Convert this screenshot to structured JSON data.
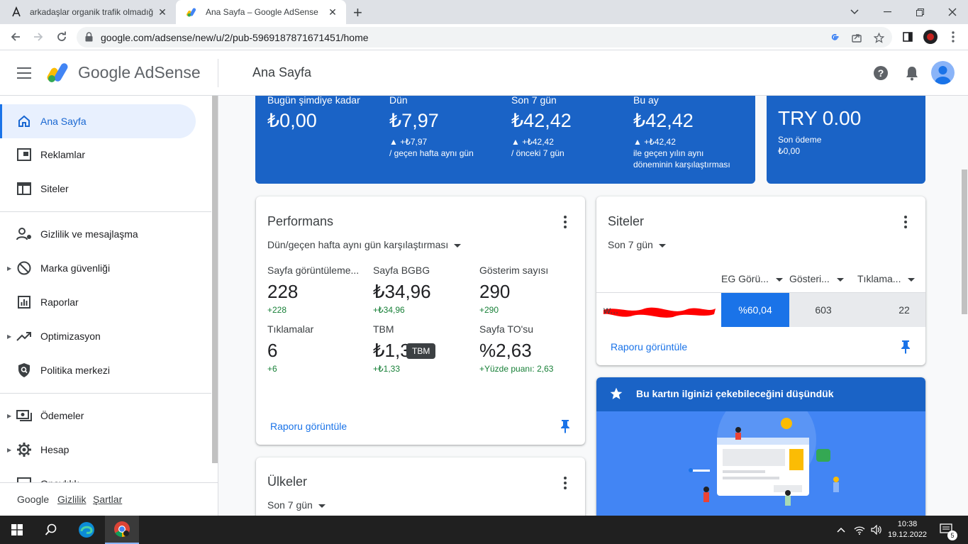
{
  "browser": {
    "tabs": [
      {
        "title": "arkadaşlar organik trafik olmadığ",
        "close": "✕"
      },
      {
        "title": "Ana Sayfa – Google AdSense",
        "close": "✕"
      }
    ],
    "url": "google.com/adsense/new/u/2/pub-5969187871671451/home"
  },
  "header": {
    "product": "Google AdSense",
    "page_title": "Ana Sayfa"
  },
  "sidebar": {
    "items": [
      {
        "label": "Ana Sayfa",
        "icon": "home-icon"
      },
      {
        "label": "Reklamlar",
        "icon": "ads-icon"
      },
      {
        "label": "Siteler",
        "icon": "sites-icon"
      },
      {
        "label": "Gizlilik ve mesajlaşma",
        "icon": "privacy-icon"
      },
      {
        "label": "Marka güvenliği",
        "icon": "block-icon"
      },
      {
        "label": "Raporlar",
        "icon": "reports-icon"
      },
      {
        "label": "Optimizasyon",
        "icon": "trending-icon"
      },
      {
        "label": "Politika merkezi",
        "icon": "policy-icon"
      },
      {
        "label": "Ödemeler",
        "icon": "payments-icon"
      },
      {
        "label": "Hesap",
        "icon": "gear-icon"
      },
      {
        "label": "Onaylılık",
        "icon": "account-icon"
      }
    ],
    "footer": {
      "brand": "Google",
      "privacy": "Gizlilik",
      "terms": "Şartlar"
    }
  },
  "earnings": {
    "today": {
      "label": "Bugün şimdiye kadar",
      "value": "₺0,00"
    },
    "yesterday": {
      "label": "Dün",
      "value": "₺7,97",
      "change": "▲ +₺7,97",
      "note": "/ geçen hafta aynı gün"
    },
    "last7": {
      "label": "Son 7 gün",
      "value": "₺42,42",
      "change": "▲ +₺42,42",
      "note": "/ önceki 7 gün"
    },
    "month": {
      "label": "Bu ay",
      "value": "₺42,42",
      "change": "▲ +₺42,42",
      "note1": "ile geçen yılın aynı",
      "note2": "döneminin karşılaştırması"
    }
  },
  "balance": {
    "value": "TRY 0.00",
    "last_payment_label": "Son ödeme",
    "last_payment_value": "₺0,00"
  },
  "performance": {
    "title": "Performans",
    "compare": "Dün/geçen hafta aynı gün karşılaştırması",
    "metrics": [
      {
        "label": "Sayfa görüntüleme...",
        "value": "228",
        "change": "+228"
      },
      {
        "label": "Sayfa BGBG",
        "value": "₺34,96",
        "change": "+₺34,96"
      },
      {
        "label": "Gösterim sayısı",
        "value": "290",
        "change": "+290"
      },
      {
        "label": "Tıklamalar",
        "value": "6",
        "change": "+6"
      },
      {
        "label": "TBM",
        "value": "₺1,33",
        "change": "+₺1,33"
      },
      {
        "label": "Sayfa TO'su",
        "value": "%2,63",
        "change": "+Yüzde puanı: 2,63"
      }
    ],
    "tooltip": "TBM",
    "link": "Raporu görüntüle"
  },
  "sites": {
    "title": "Siteler",
    "period": "Son 7 gün",
    "columns": [
      "EG Görü...",
      "Gösteri...",
      "Tıklama..."
    ],
    "row": {
      "site": "w...",
      "eg": "%60,04",
      "impressions": "603",
      "clicks": "22"
    },
    "link": "Raporu görüntüle"
  },
  "promo": {
    "title": "Bu kartın ilginizi çekebileceğini düşündük"
  },
  "countries": {
    "title": "Ülkeler",
    "period": "Son 7 gün"
  },
  "taskbar": {
    "time": "10:38",
    "date": "19.12.2022",
    "notifications": "5"
  },
  "colors": {
    "primary": "#1a73e8",
    "card_blue": "#1a63c6",
    "positive": "#188038"
  }
}
